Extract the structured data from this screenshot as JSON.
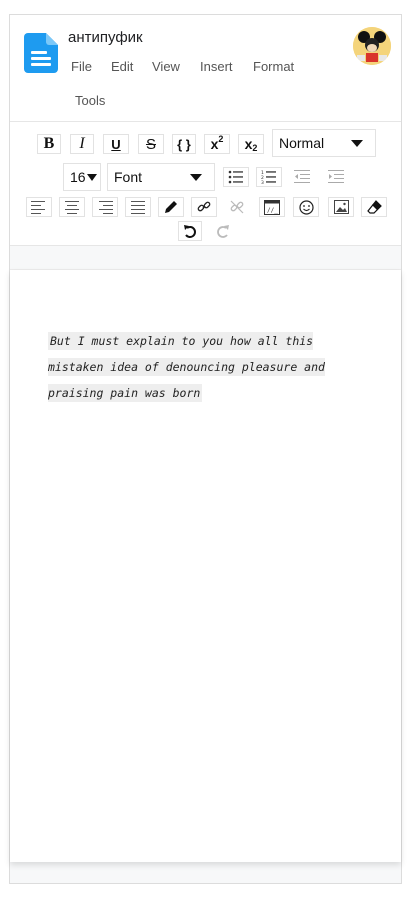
{
  "document": {
    "title": "антипуфик"
  },
  "menu": {
    "file": "File",
    "edit": "Edit",
    "view": "View",
    "insert": "Insert",
    "format": "Format",
    "tools": "Tools"
  },
  "toolbar": {
    "bold_label": "B",
    "italic_label": "I",
    "underline_label": "U",
    "strike_label": "S",
    "code_label": "{ }",
    "superscript_label": "x",
    "superscript_mark": "2",
    "subscript_label": "x",
    "subscript_mark": "2",
    "heading_select": "Normal",
    "size_select": "16",
    "font_select": "Font"
  },
  "editor": {
    "text": "But I must explain to you how all this mistaken idea of denouncing pleasure and praising pain was born"
  },
  "colors": {
    "accent": "#2196f3",
    "highlight": "#eeeeee",
    "border": "#e2e2e2"
  },
  "icons": [
    "doc-icon",
    "avatar",
    "bullet-list-icon",
    "numbered-list-icon",
    "indent-decrease-icon",
    "indent-increase-icon",
    "align-left-icon",
    "align-center-icon",
    "align-right-icon",
    "align-justify-icon",
    "pen-icon",
    "link-icon",
    "unlink-icon",
    "embed-code-icon",
    "emoji-icon",
    "image-icon",
    "eraser-icon",
    "undo-icon",
    "redo-icon"
  ]
}
